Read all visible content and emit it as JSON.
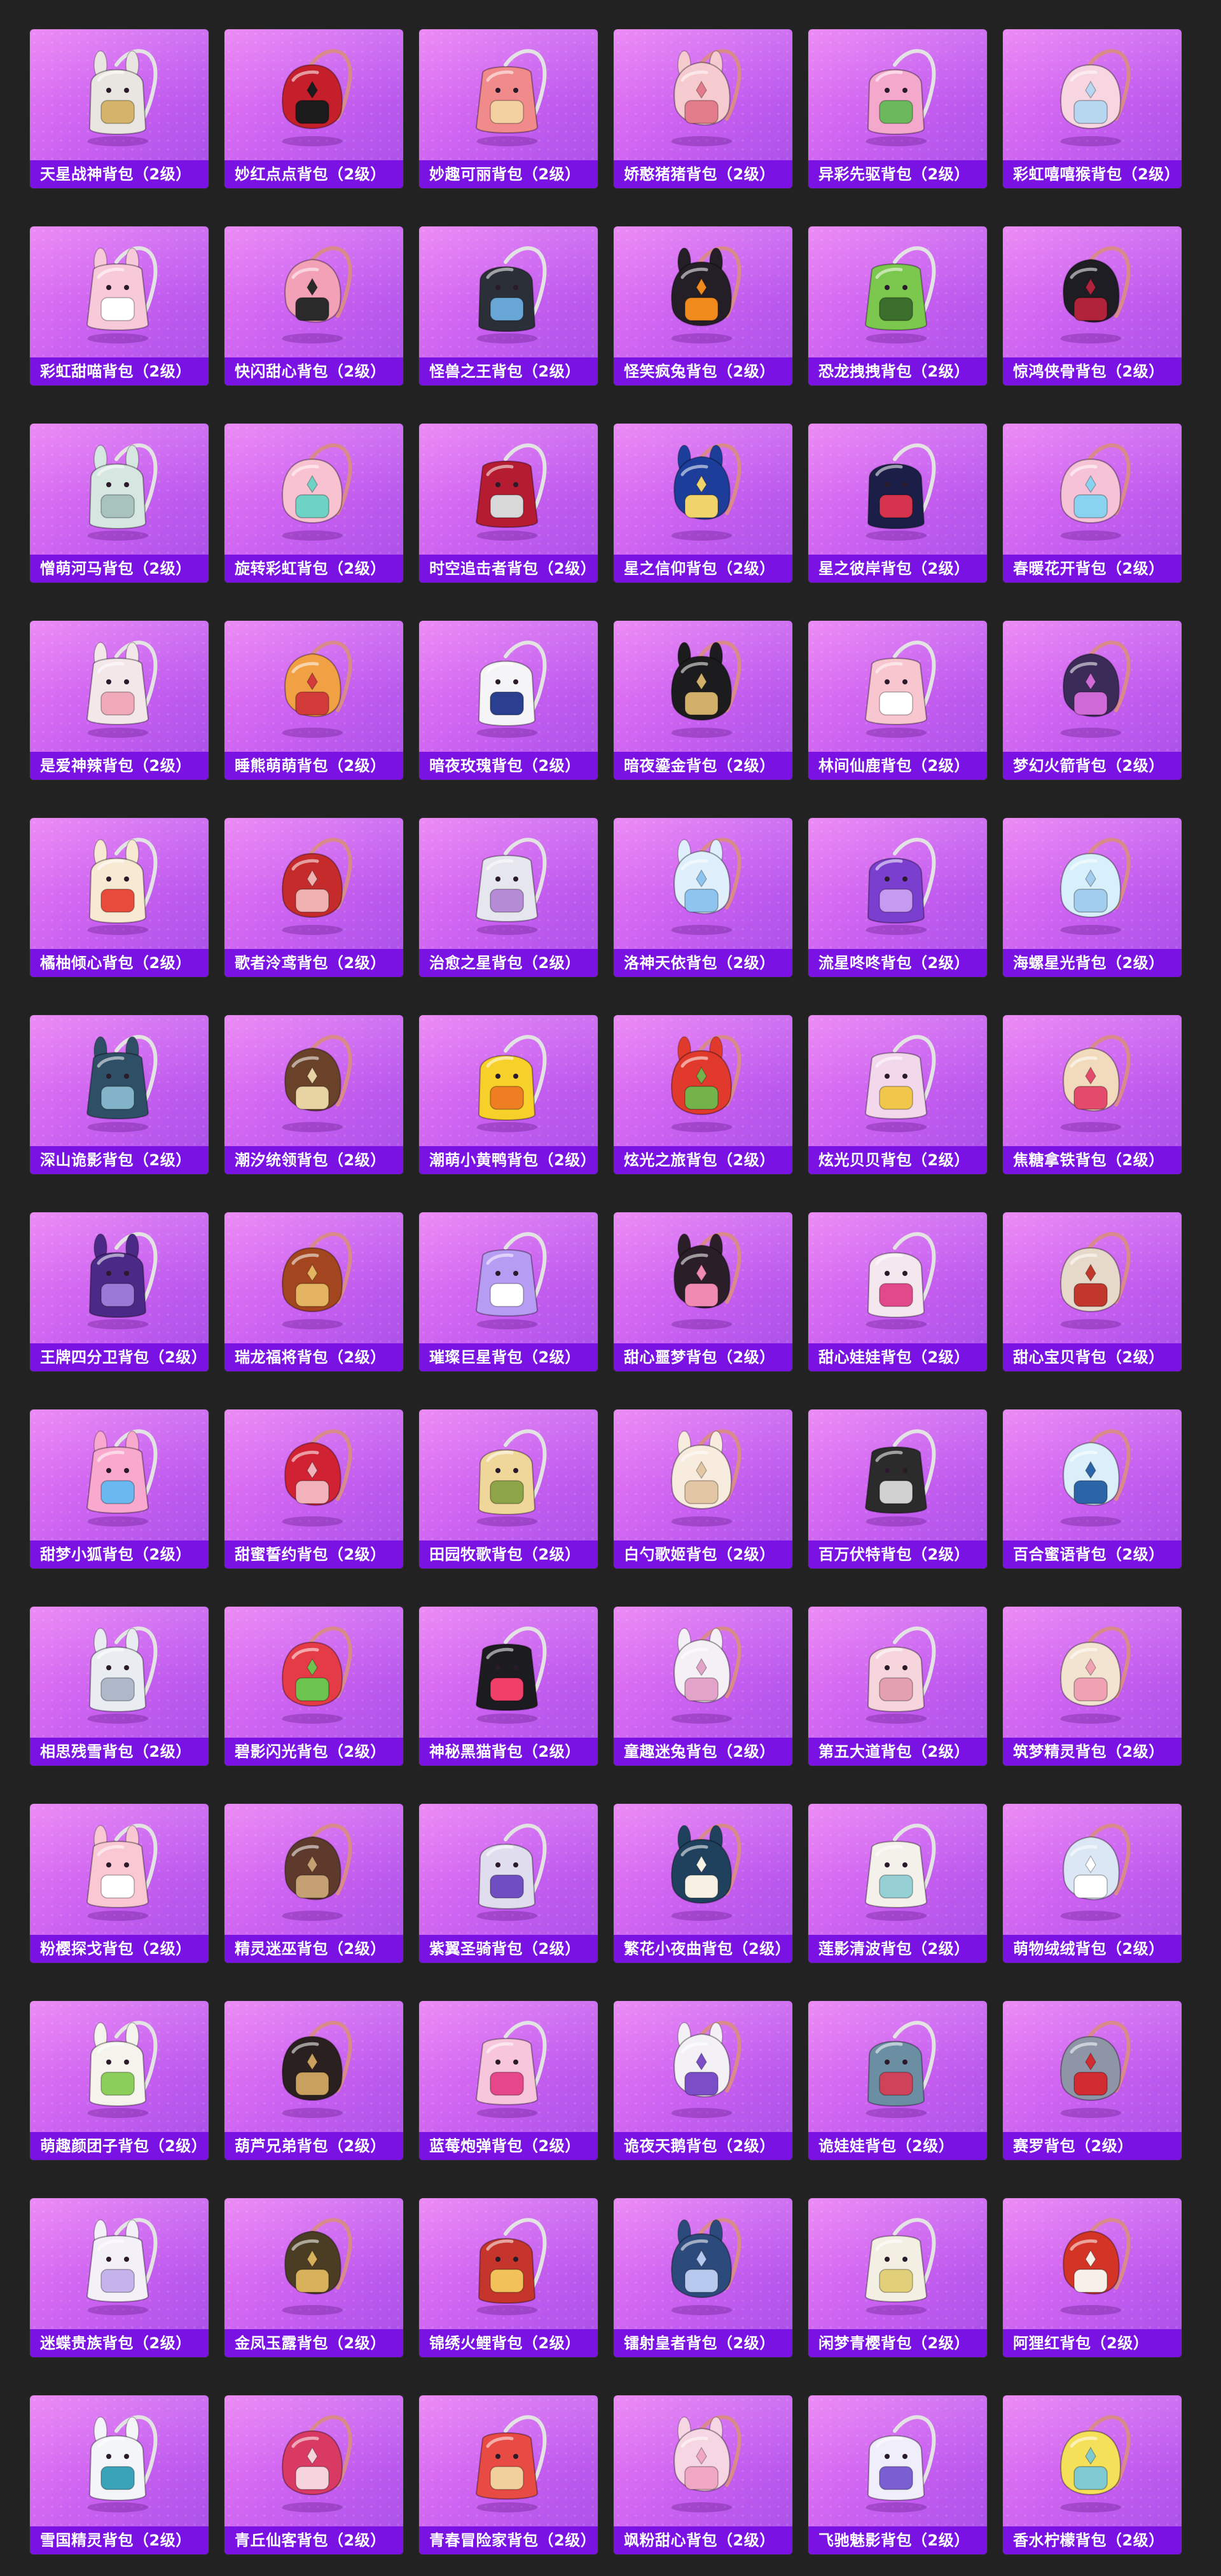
{
  "grid": {
    "items": [
      {
        "label": "天星战神背包（2级）",
        "icon": "backpack-icon",
        "color": "#e9e6e1",
        "accent": "#d4b46a"
      },
      {
        "label": "妙红点点背包（2级）",
        "icon": "backpack-icon",
        "color": "#c41f2b",
        "accent": "#1b1b1b"
      },
      {
        "label": "妙趣可丽背包（2级）",
        "icon": "backpack-icon",
        "color": "#f08a8b",
        "accent": "#f3d0a0"
      },
      {
        "label": "娇憨猪猪背包（2级）",
        "icon": "backpack-icon",
        "color": "#f6cbd0",
        "accent": "#e27c8a"
      },
      {
        "label": "异彩先驱背包（2级）",
        "icon": "backpack-icon",
        "color": "#f4a8cc",
        "accent": "#6bb85c"
      },
      {
        "label": "彩虹嘻嘻猴背包（2级）",
        "icon": "backpack-icon",
        "color": "#f7d5e1",
        "accent": "#b7d6ef"
      },
      {
        "label": "彩虹甜喵背包（2级）",
        "icon": "backpack-icon",
        "color": "#f8c9d9",
        "accent": "#ffffff"
      },
      {
        "label": "快闪甜心背包（2级）",
        "icon": "backpack-icon",
        "color": "#f2a1b7",
        "accent": "#2a2a2a"
      },
      {
        "label": "怪兽之王背包（2级）",
        "icon": "backpack-icon",
        "color": "#2b2f37",
        "accent": "#68a6d6"
      },
      {
        "label": "怪笑疯兔背包（2级）",
        "icon": "backpack-icon",
        "color": "#241f26",
        "accent": "#f08a1c"
      },
      {
        "label": "恐龙拽拽背包（2级）",
        "icon": "backpack-icon",
        "color": "#7cc74d",
        "accent": "#3b6e2c"
      },
      {
        "label": "惊鸿侠骨背包（2级）",
        "icon": "backpack-icon",
        "color": "#1d1d23",
        "accent": "#b0233a"
      },
      {
        "label": "憎萌河马背包（2级）",
        "icon": "backpack-icon",
        "color": "#d6e6e0",
        "accent": "#a8c3bd"
      },
      {
        "label": "旋转彩虹背包（2级）",
        "icon": "backpack-icon",
        "color": "#f8c2d0",
        "accent": "#6ed2c4"
      },
      {
        "label": "时空追击者背包（2级）",
        "icon": "backpack-icon",
        "color": "#b51b31",
        "accent": "#d8d8d8"
      },
      {
        "label": "星之信仰背包（2级）",
        "icon": "backpack-icon",
        "color": "#1c3e9a",
        "accent": "#f0d36a"
      },
      {
        "label": "星之彼岸背包（2级）",
        "icon": "backpack-icon",
        "color": "#1b1f48",
        "accent": "#d6334f"
      },
      {
        "label": "春暖花开背包（2级）",
        "icon": "backpack-icon",
        "color": "#f6c3d6",
        "accent": "#8ad3f0"
      },
      {
        "label": "是爱神辣背包（2级）",
        "icon": "backpack-icon",
        "color": "#f3e7ea",
        "accent": "#f0a9b9"
      },
      {
        "label": "睡熊萌萌背包（2级）",
        "icon": "backpack-icon",
        "color": "#f1a043",
        "accent": "#d33b3b"
      },
      {
        "label": "暗夜玫瑰背包（2级）",
        "icon": "backpack-icon",
        "color": "#f5f5f7",
        "accent": "#2a3f8f"
      },
      {
        "label": "暗夜鎏金背包（2级）",
        "icon": "backpack-icon",
        "color": "#1c1c1e",
        "accent": "#d2b06a"
      },
      {
        "label": "林间仙鹿背包（2级）",
        "icon": "backpack-icon",
        "color": "#f7c6cf",
        "accent": "#ffffff"
      },
      {
        "label": "梦幻火箭背包（2级）",
        "icon": "backpack-icon",
        "color": "#3a2b58",
        "accent": "#d06ad6"
      },
      {
        "label": "橘柚倾心背包（2级）",
        "icon": "backpack-icon",
        "color": "#f7e9d2",
        "accent": "#e84b3b"
      },
      {
        "label": "歌者泠鸢背包（2级）",
        "icon": "backpack-icon",
        "color": "#c52b2b",
        "accent": "#f0b1b1"
      },
      {
        "label": "治愈之星背包（2级）",
        "icon": "backpack-icon",
        "color": "#e6e6ef",
        "accent": "#b68bd6"
      },
      {
        "label": "洛神天依背包（2级）",
        "icon": "backpack-icon",
        "color": "#dfeffb",
        "accent": "#8ec4ee"
      },
      {
        "label": "流星咚咚背包（2级）",
        "icon": "backpack-icon",
        "color": "#7b3fd0",
        "accent": "#c79af2"
      },
      {
        "label": "海螺星光背包（2级）",
        "icon": "backpack-icon",
        "color": "#d8f0fb",
        "accent": "#a2cdee"
      },
      {
        "label": "深山诡影背包（2级）",
        "icon": "backpack-icon",
        "color": "#2e4f65",
        "accent": "#82b3c8"
      },
      {
        "label": "潮汐统领背包（2级）",
        "icon": "backpack-icon",
        "color": "#6a4129",
        "accent": "#e8d3a2"
      },
      {
        "label": "潮萌小黄鸭背包（2级）",
        "icon": "backpack-icon",
        "color": "#f8d02a",
        "accent": "#ef7d22"
      },
      {
        "label": "炫光之旅背包（2级）",
        "icon": "backpack-icon",
        "color": "#e13a2c",
        "accent": "#73b34a"
      },
      {
        "label": "炫光贝贝背包（2级）",
        "icon": "backpack-icon",
        "color": "#f3d7ea",
        "accent": "#f0c74b"
      },
      {
        "label": "焦糖拿铁背包（2级）",
        "icon": "backpack-icon",
        "color": "#f2dbbd",
        "accent": "#e44a6c"
      },
      {
        "label": "王牌四分卫背包（2级）",
        "icon": "backpack-icon",
        "color": "#4a2a86",
        "accent": "#9b7ad7"
      },
      {
        "label": "瑞龙福将背包（2级）",
        "icon": "backpack-icon",
        "color": "#a3451f",
        "accent": "#e5b460"
      },
      {
        "label": "璀璨巨星背包（2级）",
        "icon": "backpack-icon",
        "color": "#b79cf4",
        "accent": "#ffffff"
      },
      {
        "label": "甜心噩梦背包（2级）",
        "icon": "backpack-icon",
        "color": "#2a1f28",
        "accent": "#f08ab2"
      },
      {
        "label": "甜心娃娃背包（2级）",
        "icon": "backpack-icon",
        "color": "#f5e7ee",
        "accent": "#e1498a"
      },
      {
        "label": "甜心宝贝背包（2级）",
        "icon": "backpack-icon",
        "color": "#e7d9ca",
        "accent": "#c1372c"
      },
      {
        "label": "甜梦小狐背包（2级）",
        "icon": "backpack-icon",
        "color": "#f9a9cd",
        "accent": "#6ab8f0"
      },
      {
        "label": "甜蜜誓约背包（2级）",
        "icon": "backpack-icon",
        "color": "#d12233",
        "accent": "#f2b2bc"
      },
      {
        "label": "田园牧歌背包（2级）",
        "icon": "backpack-icon",
        "color": "#efd79a",
        "accent": "#8da448"
      },
      {
        "label": "白勺歌姬背包（2级）",
        "icon": "backpack-icon",
        "color": "#f7ecde",
        "accent": "#e3c7a5"
      },
      {
        "label": "百万伏特背包（2级）",
        "icon": "backpack-icon",
        "color": "#2b2b2b",
        "accent": "#d1d1d1"
      },
      {
        "label": "百合蜜语背包（2级）",
        "icon": "backpack-icon",
        "color": "#dbeffa",
        "accent": "#2c64a8"
      },
      {
        "label": "相思残雪背包（2级）",
        "icon": "backpack-icon",
        "color": "#e9edf1",
        "accent": "#aeb8c8"
      },
      {
        "label": "碧影闪光背包（2级）",
        "icon": "backpack-icon",
        "color": "#e53b46",
        "accent": "#6cc44f"
      },
      {
        "label": "神秘黑猫背包（2级）",
        "icon": "backpack-icon",
        "color": "#1c1b1f",
        "accent": "#f0406a"
      },
      {
        "label": "童趣迷兔背包（2级）",
        "icon": "backpack-icon",
        "color": "#f5f0f5",
        "accent": "#e3a2c7"
      },
      {
        "label": "第五大道背包（2级）",
        "icon": "backpack-icon",
        "color": "#f6d5dd",
        "accent": "#e3a0b0"
      },
      {
        "label": "筑梦精灵背包（2级）",
        "icon": "backpack-icon",
        "color": "#f3e4d1",
        "accent": "#f0a2b3"
      },
      {
        "label": "粉樱探戈背包（2级）",
        "icon": "backpack-icon",
        "color": "#f9c8d2",
        "accent": "#ffffff"
      },
      {
        "label": "精灵迷巫背包（2级）",
        "icon": "backpack-icon",
        "color": "#5d3a2b",
        "accent": "#c4a073"
      },
      {
        "label": "紫翼圣骑背包（2级）",
        "icon": "backpack-icon",
        "color": "#e0ddee",
        "accent": "#6f4ec2"
      },
      {
        "label": "繁花小夜曲背包（2级）",
        "icon": "backpack-icon",
        "color": "#20415d",
        "accent": "#f6f1e3"
      },
      {
        "label": "莲影清波背包（2级）",
        "icon": "backpack-icon",
        "color": "#f4f0ea",
        "accent": "#96cfd4"
      },
      {
        "label": "萌物绒绒背包（2级）",
        "icon": "backpack-icon",
        "color": "#dce7f6",
        "accent": "#ffffff"
      },
      {
        "label": "萌趣颜团子背包（2级）",
        "icon": "backpack-icon",
        "color": "#f4f3ec",
        "accent": "#8bcf5a"
      },
      {
        "label": "葫芦兄弟背包（2级）",
        "icon": "backpack-icon",
        "color": "#2a2020",
        "accent": "#caa05e"
      },
      {
        "label": "蓝莓炮弹背包（2级）",
        "icon": "backpack-icon",
        "color": "#f7c5dc",
        "accent": "#e6468a"
      },
      {
        "label": "诡夜天鹅背包（2级）",
        "icon": "backpack-icon",
        "color": "#f3f1f6",
        "accent": "#7b4ec8"
      },
      {
        "label": "诡娃娃背包（2级）",
        "icon": "backpack-icon",
        "color": "#6b8ea3",
        "accent": "#d0425a"
      },
      {
        "label": "赛罗背包（2级）",
        "icon": "backpack-icon",
        "color": "#8d95a6",
        "accent": "#d22b32"
      },
      {
        "label": "迷蝶贵族背包（2级）",
        "icon": "backpack-icon",
        "color": "#f3f0f8",
        "accent": "#c5b4ec"
      },
      {
        "label": "金凤玉露背包（2级）",
        "icon": "backpack-icon",
        "color": "#4a3d24",
        "accent": "#d9b15a"
      },
      {
        "label": "锦绣火鲤背包（2级）",
        "icon": "backpack-icon",
        "color": "#c6352b",
        "accent": "#f2c15a"
      },
      {
        "label": "镭射皇者背包（2级）",
        "icon": "backpack-icon",
        "color": "#2d4a7c",
        "accent": "#b7c9ef"
      },
      {
        "label": "闲梦青樱背包（2级）",
        "icon": "backpack-icon",
        "color": "#f3efe3",
        "accent": "#e2cf7a"
      },
      {
        "label": "阿狸红背包（2级）",
        "icon": "backpack-icon",
        "color": "#d33425",
        "accent": "#f6f0e8"
      },
      {
        "label": "雪国精灵背包（2级）",
        "icon": "backpack-icon",
        "color": "#f3f5f9",
        "accent": "#3aa3b8"
      },
      {
        "label": "青丘仙客背包（2级）",
        "icon": "backpack-icon",
        "color": "#d93a64",
        "accent": "#f5d4de"
      },
      {
        "label": "青春冒险家背包（2级）",
        "icon": "backpack-icon",
        "color": "#e84b43",
        "accent": "#f2d09e"
      },
      {
        "label": "飒粉甜心背包（2级）",
        "icon": "backpack-icon",
        "color": "#f6d6e2",
        "accent": "#f0a7c2"
      },
      {
        "label": "飞驰魅影背包（2级）",
        "icon": "backpack-icon",
        "color": "#f1eefb",
        "accent": "#7b5fd2"
      },
      {
        "label": "香水柠檬背包（2级）",
        "icon": "backpack-icon",
        "color": "#f5e05a",
        "accent": "#7fc9d2"
      }
    ]
  }
}
